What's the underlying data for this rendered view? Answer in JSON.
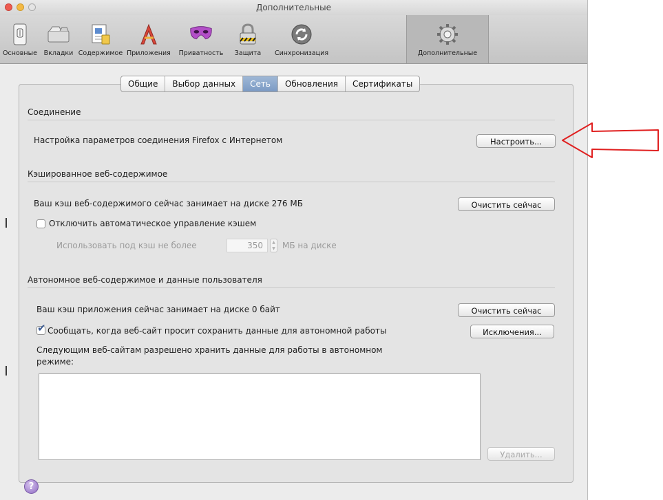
{
  "window": {
    "title": "Дополнительные"
  },
  "toolbar": {
    "items": [
      {
        "label": "Основные",
        "icon": "switch-icon"
      },
      {
        "label": "Вкладки",
        "icon": "tabs-icon"
      },
      {
        "label": "Содержимое",
        "icon": "content-icon"
      },
      {
        "label": "Приложения",
        "icon": "applications-icon"
      },
      {
        "label": "Приватность",
        "icon": "mask-icon"
      },
      {
        "label": "Защита",
        "icon": "lock-icon"
      },
      {
        "label": "Синхронизация",
        "icon": "sync-icon"
      },
      {
        "label": "Дополнительные",
        "icon": "gear-icon"
      }
    ],
    "selected": "Дополнительные"
  },
  "tabs": {
    "items": [
      "Общие",
      "Выбор данных",
      "Сеть",
      "Обновления",
      "Сертификаты"
    ],
    "selected": "Сеть"
  },
  "connection": {
    "heading": "Соединение",
    "description": "Настройка параметров соединения Firefox с Интернетом",
    "configure_button": "Настроить..."
  },
  "cache": {
    "heading": "Кэшированное веб-содержимое",
    "usage_text": "Ваш кэш веб-содержимого сейчас занимает на диске 276 МБ",
    "clear_button": "Очистить сейчас",
    "override_label": "Отключить автоматическое управление кэшем",
    "override_checked": false,
    "limit_prefix": "Использовать под кэш не более",
    "limit_value": "350",
    "limit_suffix": "МБ на диске"
  },
  "offline": {
    "heading": "Автономное веб-содержимое и данные пользователя",
    "usage_text": "Ваш кэш приложения сейчас занимает на диске 0 байт",
    "clear_button": "Очистить сейчас",
    "notify_label": "Сообщать, когда веб-сайт просит сохранить данные для автономной работы",
    "notify_checked": true,
    "exceptions_button": "Исключения...",
    "sites_label_line1": "Следующим веб-сайтам разрешено хранить данные для работы в автономном",
    "sites_label_line2": "режиме:",
    "sites": [],
    "remove_button": "Удалить..."
  },
  "help": {
    "symbol": "?"
  },
  "colors": {
    "annotation_arrow": "#e02020",
    "selected_tab": "#7b9ac4",
    "checkmark": "#3f5f95"
  }
}
